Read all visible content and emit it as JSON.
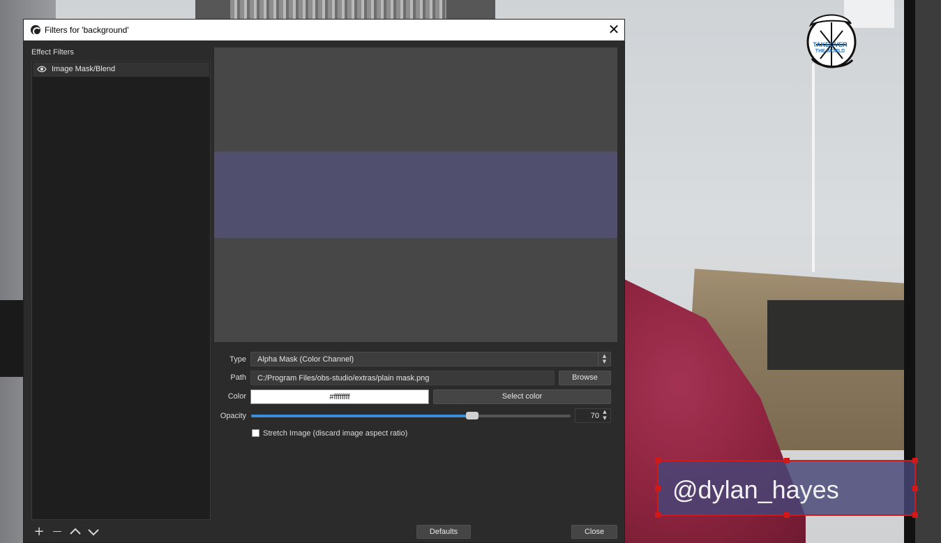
{
  "dialog": {
    "title": "Filters for 'background'",
    "close_glyph": "✕",
    "effect_filters_label": "Effect Filters",
    "filters": [
      {
        "label": "Image Mask/Blend",
        "icon": "eye-icon",
        "visible": true
      }
    ],
    "list_tools": {
      "add": "+",
      "remove": "—",
      "move_up": "⌃",
      "move_down": "⌄"
    },
    "properties": {
      "type_label": "Type",
      "type_value": "Alpha Mask (Color Channel)",
      "path_label": "Path",
      "path_value": "C:/Program Files/obs-studio/extras/plain mask.png",
      "browse_label": "Browse",
      "color_label": "Color",
      "color_value": "#ffffffff",
      "select_color_label": "Select color",
      "opacity_label": "Opacity",
      "opacity_value": "70",
      "opacity_fraction": 0.7,
      "stretch_label": "Stretch Image (discard image aspect ratio)",
      "stretch_checked": false
    },
    "defaults_label": "Defaults",
    "close_label": "Close",
    "preview_band_color": "#514f6e"
  },
  "scene": {
    "username": "@dylan_hayes",
    "logo_text": "TAKEOVER",
    "logo_subtext": "THE WORLD",
    "selection_color": "#d41818"
  }
}
